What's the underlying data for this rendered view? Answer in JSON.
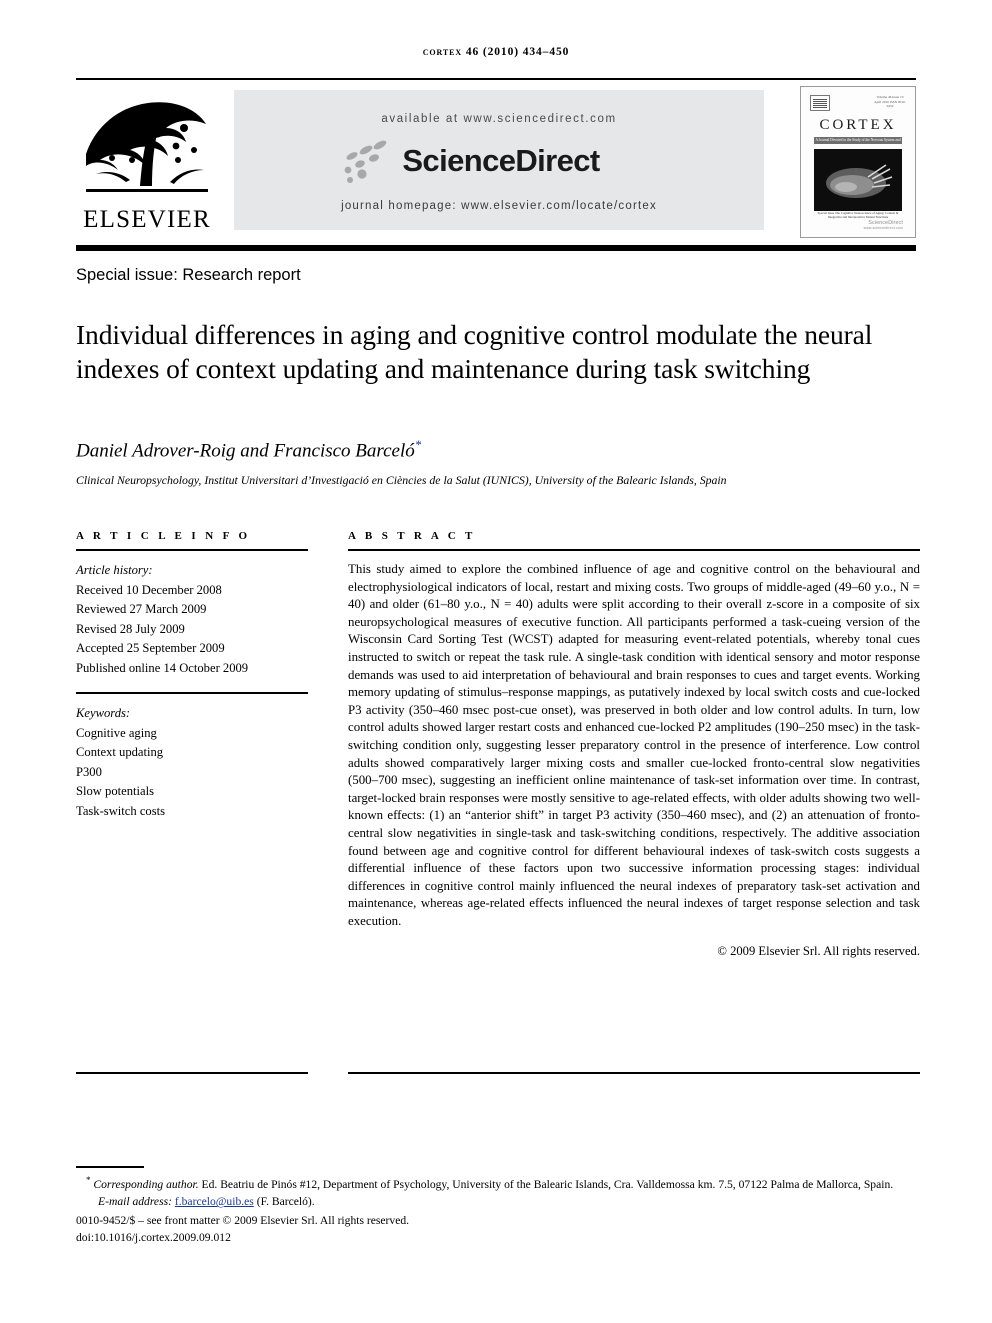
{
  "running_head": "cortex 46 (2010) 434–450",
  "masthead": {
    "publisher_name": "ELSEVIER",
    "available_at": "available at www.sciencedirect.com",
    "sciencedirect_wordmark": "ScienceDirect",
    "journal_homepage": "journal homepage: www.elsevier.com/locate/cortex",
    "cover": {
      "title": "CORTEX",
      "subtitle": "A Journal Devoted to the Study of the Nervous System and Behaviour",
      "meta": "Volume 46 Issue 10 April 2010 ISSN 0010-9452",
      "caption": "Special Issue The Cognitive Neuroscience of Aging: Context & Integrative and Interpretative Mental Functions",
      "sciencedirect_label": "ScienceDirect",
      "sciencedirect_sub": "www.sciencedirect.com"
    }
  },
  "article_type": "Special issue: Research report",
  "title": "Individual differences in aging and cognitive control modulate the neural indexes of context updating and maintenance during task switching",
  "authors": "Daniel Adrover-Roig and Francisco Barceló",
  "author_marker": "*",
  "affiliation": "Clinical Neuropsychology, Institut Universitari d’Investigació en Ciències de la Salut (IUNICS), University of the Balearic Islands, Spain",
  "article_info": {
    "label": "A R T I C L E  I N F O",
    "history_title": "Article history:",
    "history": [
      "Received 10 December 2008",
      "Reviewed 27 March 2009",
      "Revised 28 July 2009",
      "Accepted 25 September 2009",
      "Published online 14 October 2009"
    ],
    "keywords_title": "Keywords:",
    "keywords": [
      "Cognitive aging",
      "Context updating",
      "P300",
      "Slow potentials",
      "Task-switch costs"
    ]
  },
  "abstract": {
    "label": "A B S T R A C T",
    "text": "This study aimed to explore the combined influence of age and cognitive control on the behavioural and electrophysiological indicators of local, restart and mixing costs. Two groups of middle-aged (49–60 y.o., N = 40) and older (61–80 y.o., N = 40) adults were split according to their overall z-score in a composite of six neuropsychological measures of executive function. All participants performed a task-cueing version of the Wisconsin Card Sorting Test (WCST) adapted for measuring event-related potentials, whereby tonal cues instructed to switch or repeat the task rule. A single-task condition with identical sensory and motor response demands was used to aid interpretation of behavioural and brain responses to cues and target events. Working memory updating of stimulus–response mappings, as putatively indexed by local switch costs and cue-locked P3 activity (350–460 msec post-cue onset), was preserved in both older and low control adults. In turn, low control adults showed larger restart costs and enhanced cue-locked P2 amplitudes (190–250 msec) in the task-switching condition only, suggesting lesser preparatory control in the presence of interference. Low control adults showed comparatively larger mixing costs and smaller cue-locked fronto-central slow negativities (500–700 msec), suggesting an inefficient online maintenance of task-set information over time. In contrast, target-locked brain responses were mostly sensitive to age-related effects, with older adults showing two well-known effects: (1) an “anterior shift” in target P3 activity (350–460 msec), and (2) an attenuation of fronto-central slow negativities in single-task and task-switching conditions, respectively. The additive association found between age and cognitive control for different behavioural indexes of task-switch costs suggests a differential influence of these factors upon two successive information processing stages: individual differences in cognitive control mainly influenced the neural indexes of preparatory task-set activation and maintenance, whereas age-related effects influenced the neural indexes of target response selection and task execution.",
    "copyright": "© 2009 Elsevier Srl. All rights reserved."
  },
  "footnotes": {
    "corresponding_marker": "*",
    "corresponding_label": "Corresponding author.",
    "corresponding_address": " Ed. Beatriu de Pinós #12, Department of Psychology, University of the Balearic Islands, Cra. Valldemossa km. 7.5, 07122 Palma de Mallorca, Spain.",
    "email_label": "E-mail address:",
    "email": "f.barcelo@uib.es",
    "email_owner": "(F. Barceló).",
    "front_matter": "0010-9452/$ – see front matter © 2009 Elsevier Srl. All rights reserved.",
    "doi": "doi:10.1016/j.cortex.2009.09.012"
  }
}
